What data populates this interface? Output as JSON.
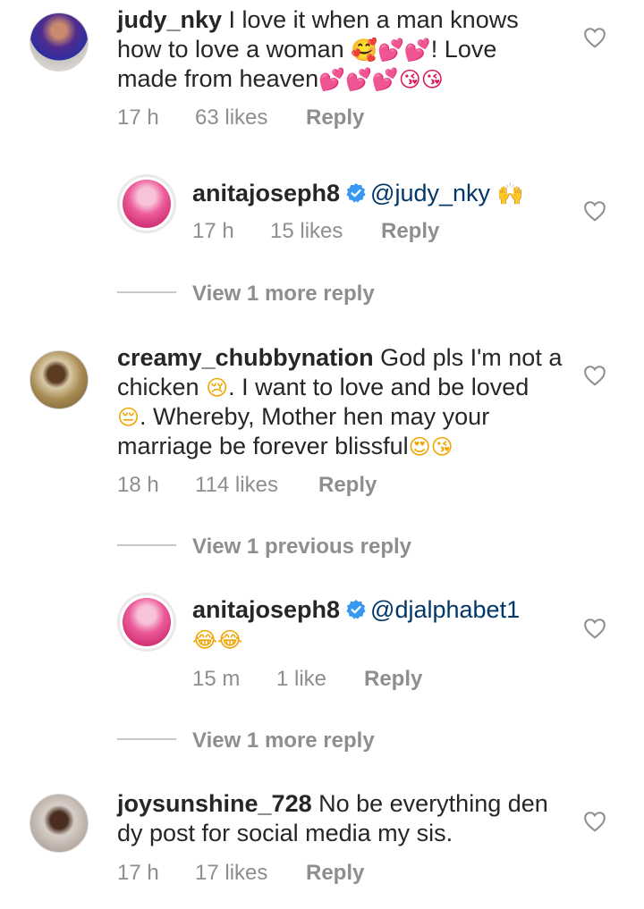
{
  "comments": [
    {
      "username": "judy_nky",
      "text_1": " I love it when a man knows",
      "text_2": "how to love a woman ",
      "emojis_2": "🥰💕💕",
      "text_2b": "! Love",
      "text_3": "made from heaven",
      "emojis_3": "💕💕💕😘😘",
      "time": "17 h",
      "likes": "63 likes",
      "reply": "Reply"
    },
    {
      "username": "anitajoseph8",
      "mention": "@judy_nky",
      "emojis": "🙌",
      "time": "17 h",
      "likes": "15 likes",
      "reply": "Reply"
    },
    {
      "username": "creamy_chubbynation",
      "text_1": " God pls I'm not a",
      "text_2": "chicken ",
      "emoji_2": "😢",
      "text_2b": ". I want to love and be loved",
      "emoji_3": "😔",
      "text_3": ". Whereby, Mother hen may your",
      "text_4": "marriage be forever blissful",
      "emojis_4": "😍😘",
      "time": "18 h",
      "likes": "114 likes",
      "reply": "Reply"
    },
    {
      "username": "anitajoseph8",
      "mention": "@djalphabet1",
      "emojis": "😂😂",
      "time": "15 m",
      "likes": "1 like",
      "reply": "Reply"
    },
    {
      "username": "joysunshine_728",
      "text_1": " No be everything den",
      "text_2": "dy post for social media my sis.",
      "time": "17 h",
      "likes": "17 likes",
      "reply": "Reply"
    }
  ],
  "view_more": [
    "View 1 more reply",
    "View 1 previous reply",
    "View 1 more reply"
  ],
  "colors": {
    "text": "#262626",
    "meta": "#8e8e8e",
    "mention": "#00376b",
    "verified": "#3897f0"
  },
  "icons": {
    "like": "heart-outline-icon",
    "verified": "verified-badge-icon"
  }
}
